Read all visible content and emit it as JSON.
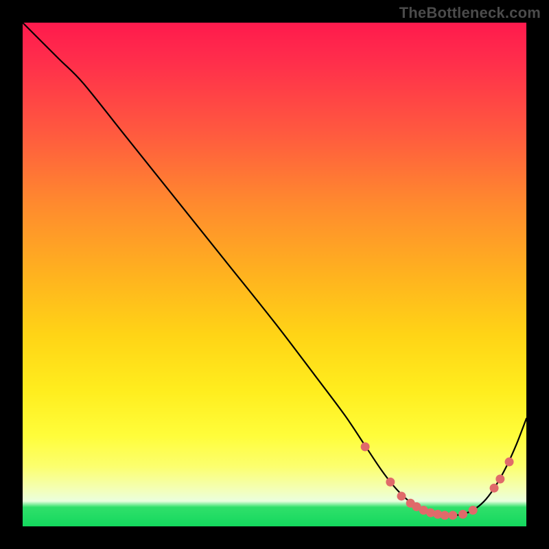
{
  "watermark": "TheBottleneck.com",
  "colors": {
    "curve": "#000000",
    "dot": "#e06a6a",
    "gradient_top": "#ff1a4d",
    "gradient_bottom": "#14d85e"
  },
  "chart_data": {
    "type": "line",
    "title": "",
    "xlabel": "",
    "ylabel": "",
    "xlim": [
      0,
      100
    ],
    "ylim": [
      0,
      100
    ],
    "series": [
      {
        "name": "curve",
        "x": [
          0,
          7,
          12,
          20,
          30,
          40,
          50,
          58,
          64,
          68,
          71,
          73.5,
          76,
          78.5,
          81,
          83.5,
          86,
          88,
          90,
          92,
          94,
          96,
          98,
          100
        ],
        "y": [
          100,
          93,
          88,
          78,
          65.5,
          53,
          40.5,
          30,
          22,
          16,
          11.5,
          8.2,
          5.6,
          3.8,
          2.7,
          2.2,
          2.2,
          2.6,
          3.6,
          5.4,
          8.2,
          11.8,
          16.2,
          21.4
        ]
      }
    ],
    "points": [
      {
        "x": 68.0,
        "y": 15.8
      },
      {
        "x": 73.0,
        "y": 8.8
      },
      {
        "x": 75.2,
        "y": 6.0
      },
      {
        "x": 77.0,
        "y": 4.6
      },
      {
        "x": 78.2,
        "y": 3.9
      },
      {
        "x": 79.6,
        "y": 3.2
      },
      {
        "x": 81.0,
        "y": 2.7
      },
      {
        "x": 82.4,
        "y": 2.4
      },
      {
        "x": 83.8,
        "y": 2.2
      },
      {
        "x": 85.4,
        "y": 2.2
      },
      {
        "x": 87.4,
        "y": 2.4
      },
      {
        "x": 89.4,
        "y": 3.2
      },
      {
        "x": 93.6,
        "y": 7.6
      },
      {
        "x": 94.8,
        "y": 9.4
      },
      {
        "x": 96.6,
        "y": 12.8
      }
    ],
    "dot_radius": 6.5
  }
}
